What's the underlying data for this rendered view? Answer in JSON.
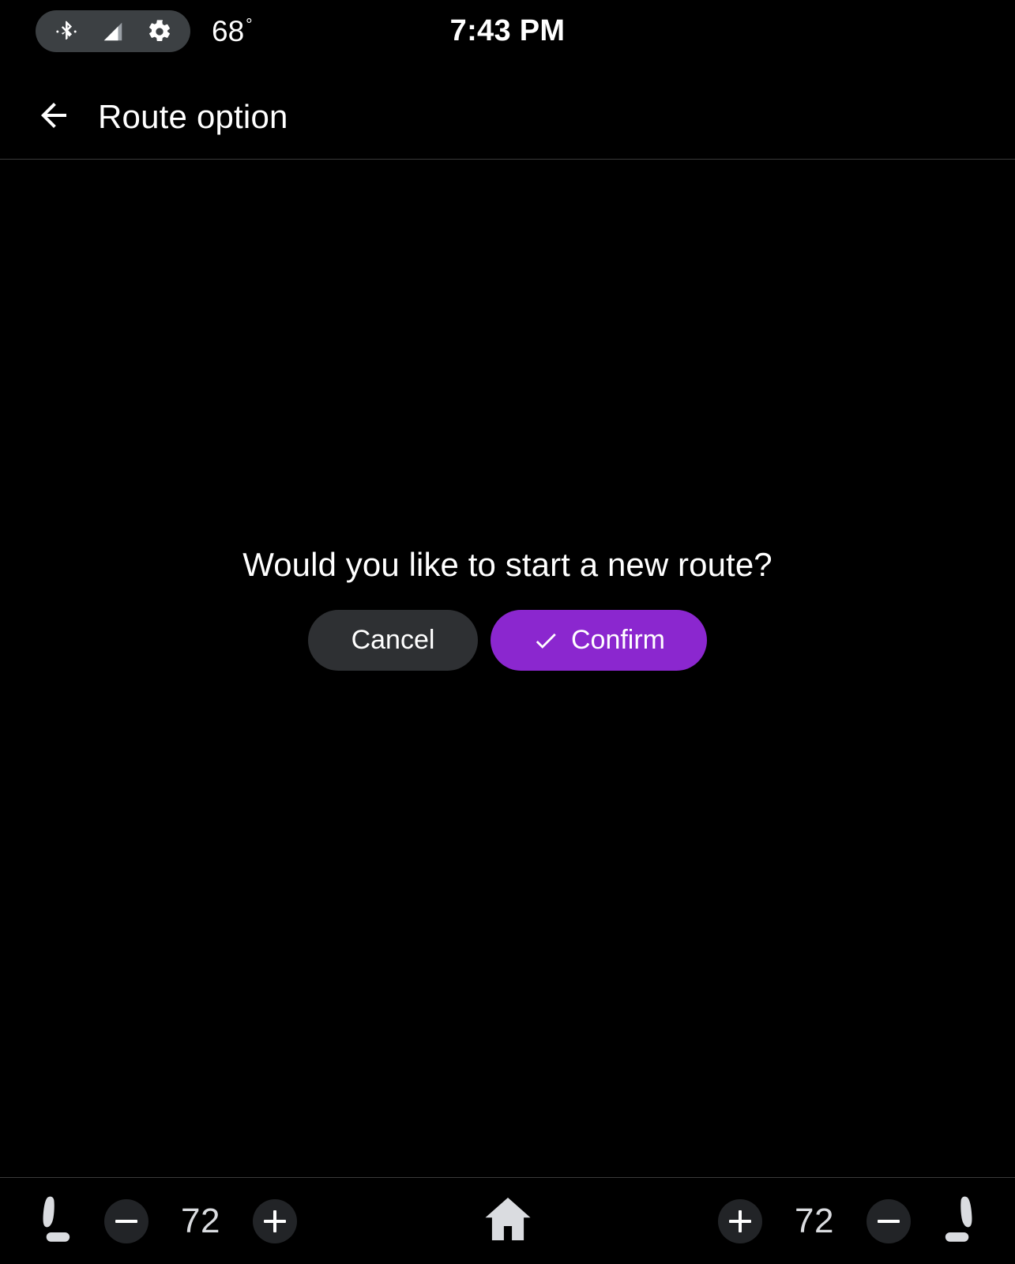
{
  "status_bar": {
    "pill_icons": [
      {
        "name": "bluetooth-icon",
        "label": "Bluetooth"
      },
      {
        "name": "cell-signal-icon",
        "label": "Cellular signal"
      },
      {
        "name": "settings-gear-icon",
        "label": "Settings"
      }
    ],
    "temperature": "68",
    "degree_symbol": "°",
    "clock": "7:43 PM"
  },
  "app_bar": {
    "back_icon": "arrow-left-icon",
    "title": "Route option"
  },
  "dialog": {
    "message": "Would you like to start a new route?",
    "cancel_label": "Cancel",
    "confirm_label": "Confirm",
    "confirm_icon": "check-icon"
  },
  "bottom_bar": {
    "left": {
      "seat_icon": "driver-seat-icon",
      "decrease_icon": "minus-icon",
      "temperature": "72",
      "increase_icon": "plus-icon"
    },
    "home_icon": "home-icon",
    "right": {
      "increase_icon": "plus-icon",
      "temperature": "72",
      "decrease_icon": "minus-icon",
      "seat_icon": "passenger-seat-icon"
    }
  },
  "colors": {
    "background": "#000000",
    "accent_purple": "#8B27CF",
    "cancel_gray": "#2E3033",
    "pill_gray": "#3C4043",
    "step_button_gray": "#222427",
    "icon_light": "#DADCE0",
    "divider": "#3A3A3A",
    "text_primary": "#FFFFFF"
  }
}
